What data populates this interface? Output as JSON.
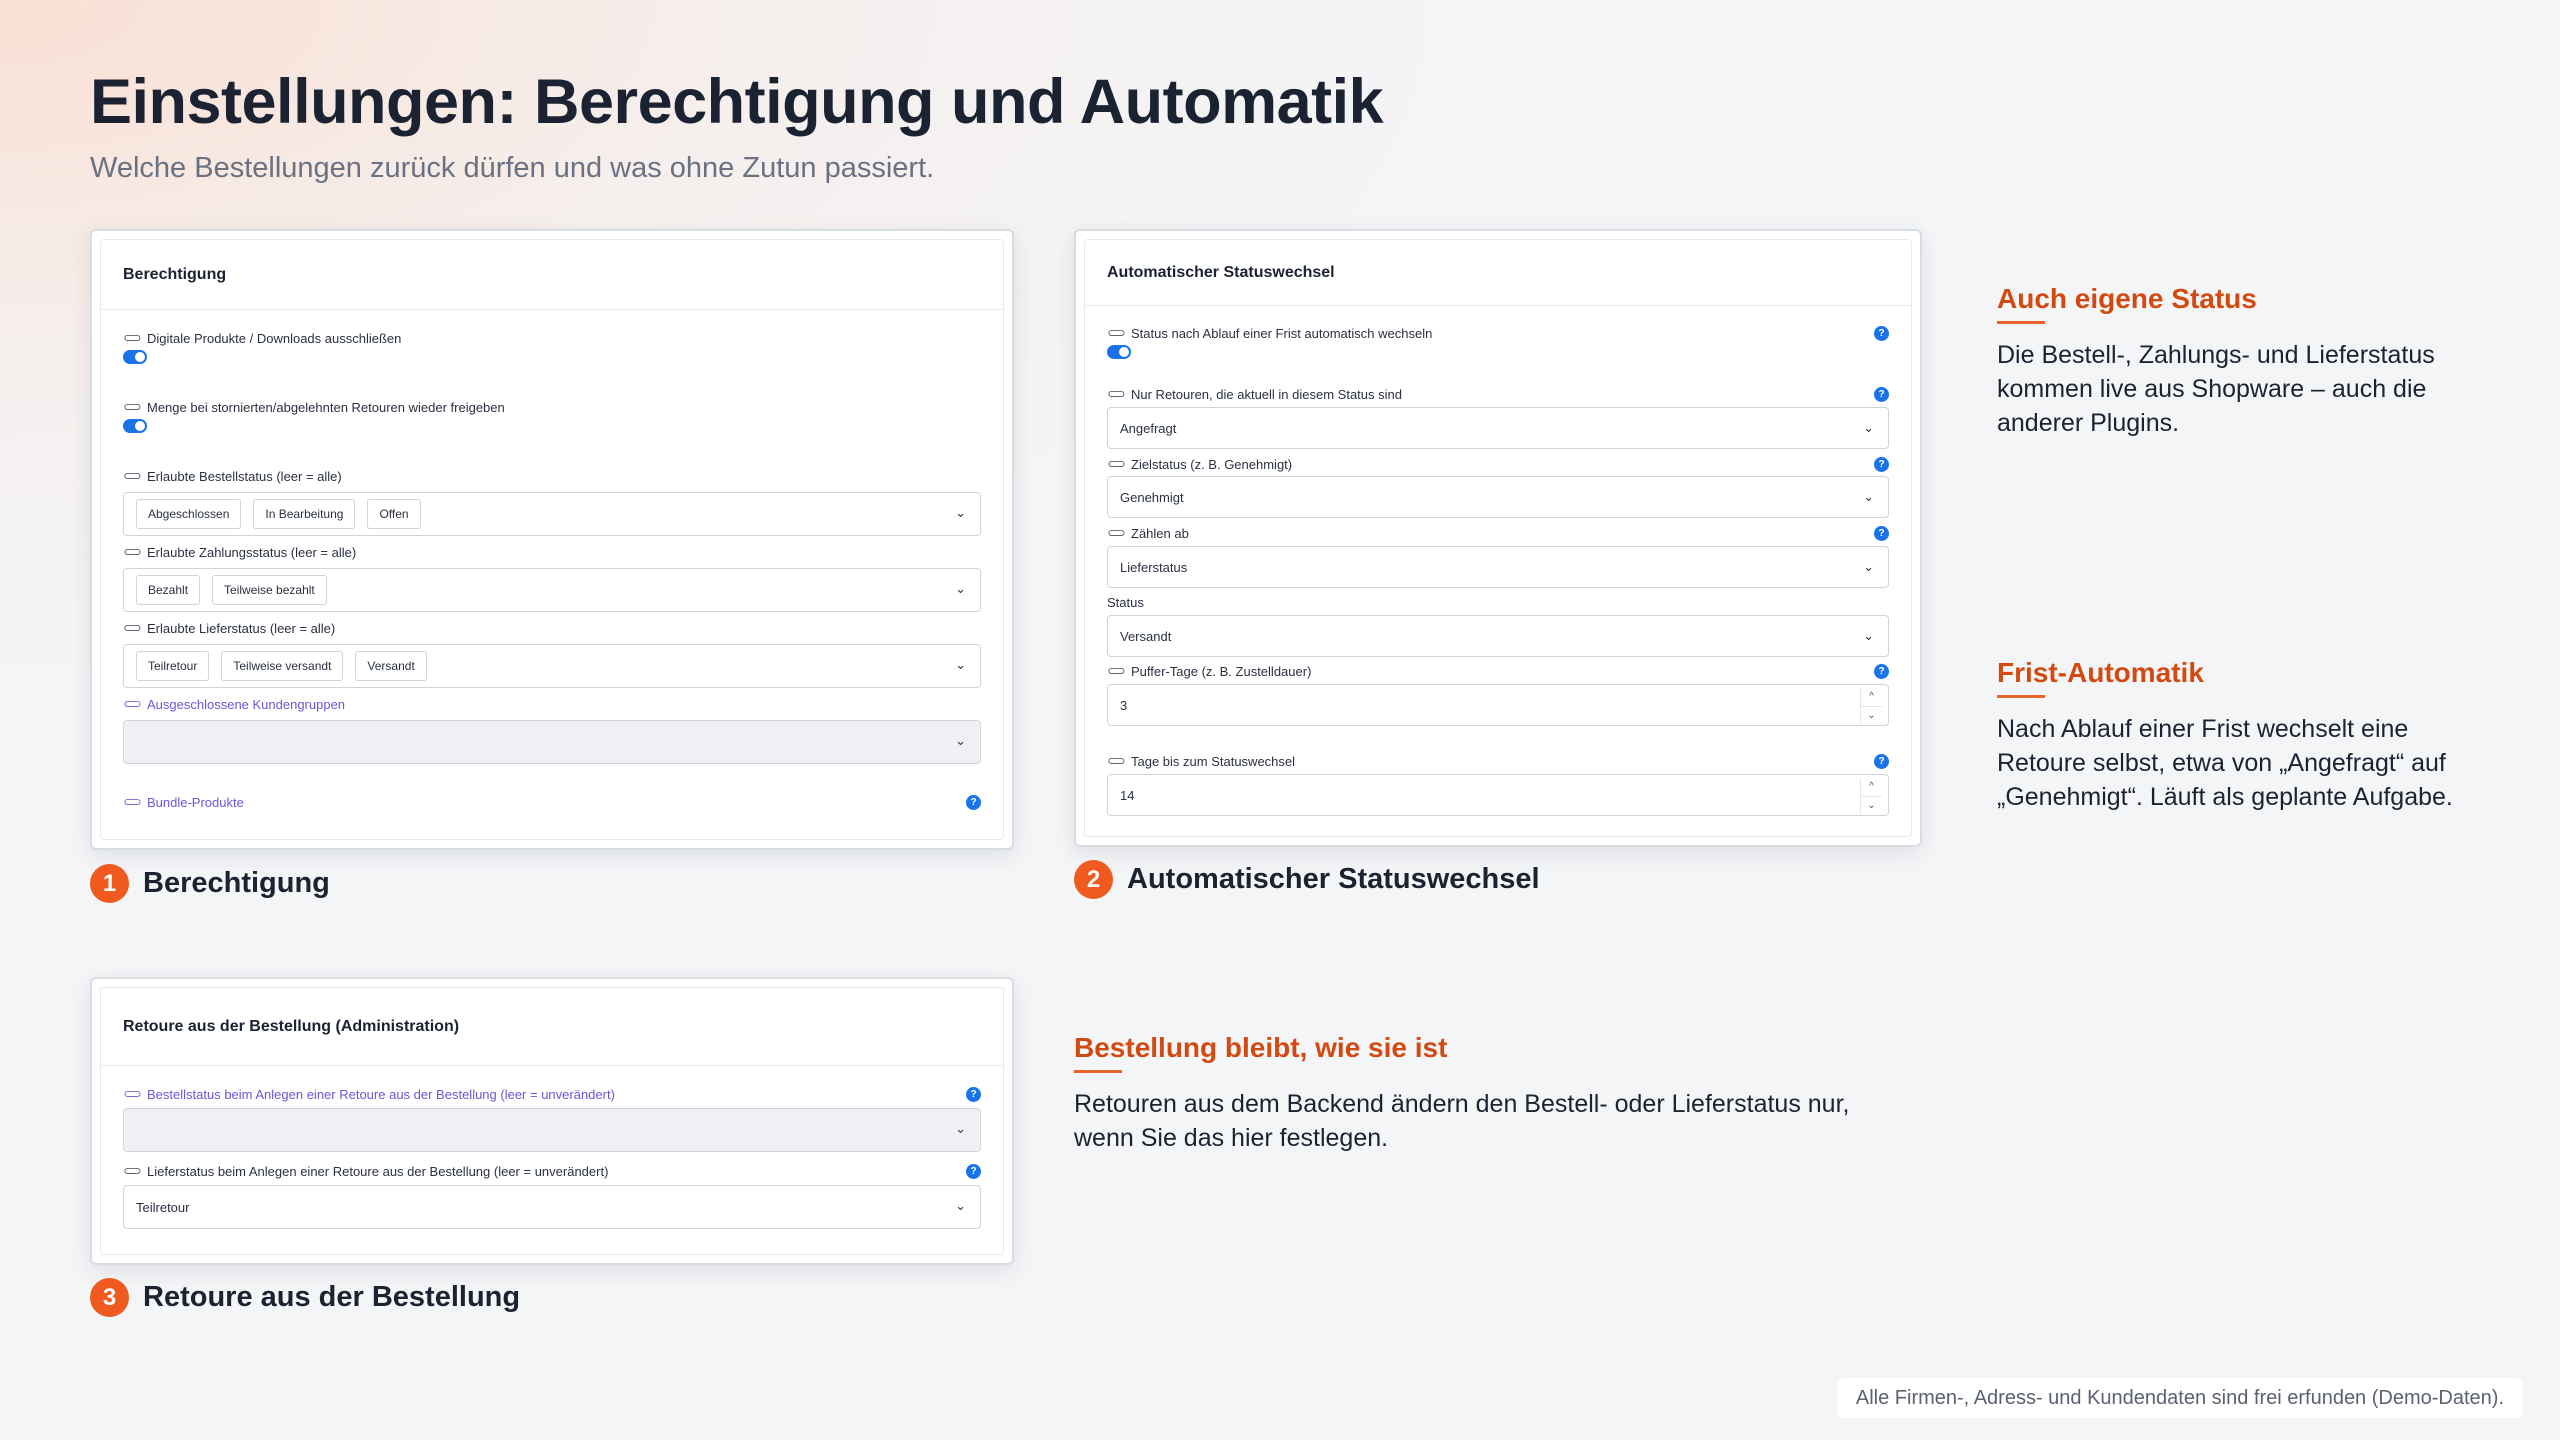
{
  "title": "Einstellungen: Berechtigung und Automatik",
  "subtitle": "Welche Bestellungen zurück dürfen und was ohne Zutun passiert.",
  "panel1": {
    "header": "Berechtigung",
    "toggle1_label": "Digitale Produkte / Downloads ausschließen",
    "toggle2_label": "Menge bei stornierten/abgelehnten Retouren wieder freigeben",
    "order_status_label": "Erlaubte Bestellstatus (leer = alle)",
    "order_status_chips": [
      "Abgeschlossen",
      "In Bearbeitung",
      "Offen"
    ],
    "payment_status_label": "Erlaubte Zahlungsstatus (leer = alle)",
    "payment_status_chips": [
      "Bezahlt",
      "Teilweise bezahlt"
    ],
    "delivery_status_label": "Erlaubte Lieferstatus (leer = alle)",
    "delivery_status_chips": [
      "Teilretour",
      "Teilweise versandt",
      "Versandt"
    ],
    "excluded_groups_label": "Ausgeschlossene Kundengruppen",
    "bundle_label": "Bundle-Produkte",
    "help": "?"
  },
  "caption1": {
    "number": "1",
    "label": "Berechtigung"
  },
  "panel2": {
    "header": "Automatischer Statuswechsel",
    "auto_switch_label": "Status nach Ablauf einer Frist automatisch wechseln",
    "only_returns_label": "Nur Retouren, die aktuell in diesem Status sind",
    "only_returns_value": "Angefragt",
    "target_status_label": "Zielstatus (z. B. Genehmigt)",
    "target_status_value": "Genehmigt",
    "count_from_label": "Zählen ab",
    "count_from_value": "Lieferstatus",
    "status_label": "Status",
    "status_value": "Versandt",
    "buffer_label": "Puffer-Tage (z. B. Zustelldauer)",
    "buffer_value": "3",
    "days_label": "Tage bis zum Statuswechsel",
    "days_value": "14",
    "help": "?"
  },
  "caption2": {
    "number": "2",
    "label": "Automatischer Statuswechsel"
  },
  "panel3": {
    "header": "Retoure aus der Bestellung (Administration)",
    "order_status_label": "Bestellstatus beim Anlegen einer Retoure aus der Bestellung (leer = unverändert)",
    "delivery_status_label": "Lieferstatus beim Anlegen einer Retoure aus der Bestellung (leer = unverändert)",
    "delivery_status_value": "Teilretour",
    "help": "?"
  },
  "caption3": {
    "number": "3",
    "label": "Retoure aus der Bestellung"
  },
  "notes": [
    {
      "title": "Auch eigene Status",
      "text": "Die Bestell-, Zahlungs- und Lieferstatus kommen live aus Shopware – auch die anderer Plugins."
    },
    {
      "title": "Frist-Automatik",
      "text": "Nach Ablauf einer Frist wechselt eine Retoure selbst, etwa von „Angefragt“ auf „Genehmigt“. Läuft als geplante Aufgabe."
    },
    {
      "title": "Bestellung bleibt, wie sie ist",
      "text": "Retouren aus dem Backend ändern den Bestell- oder Lieferstatus nur, wenn Sie das hier festlegen."
    }
  ],
  "footer": "Alle Firmen-, Adress- und Kundendaten sind frei erfunden (Demo-Daten).",
  "icons": {
    "link": "link-icon",
    "help": "help-icon",
    "chevron": "chevron-down-icon"
  },
  "colors": {
    "accent": "#f15a1f",
    "note_title": "#d24a12",
    "toggle": "#1a73e8",
    "link": "#6e55d8"
  }
}
